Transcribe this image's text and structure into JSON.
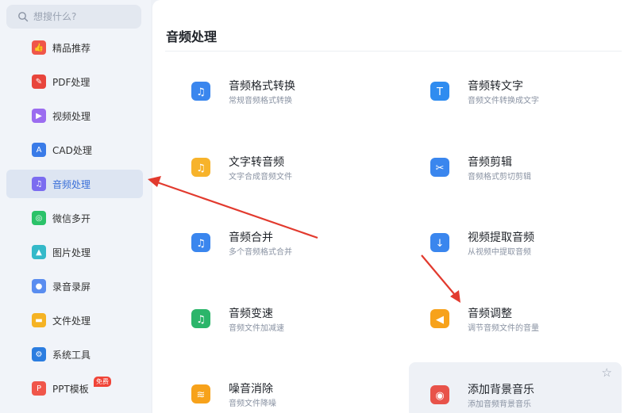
{
  "search": {
    "placeholder": "想搜什么?"
  },
  "sidebar": {
    "items": [
      {
        "label": "精品推荐",
        "color": "#f0564a",
        "glyph": "👍",
        "active": false
      },
      {
        "label": "PDF处理",
        "color": "#e8453c",
        "glyph": "✎",
        "active": false
      },
      {
        "label": "视频处理",
        "color": "#9b6cf0",
        "glyph": "▶",
        "active": false
      },
      {
        "label": "CAD处理",
        "color": "#3a7be8",
        "glyph": "A",
        "active": false
      },
      {
        "label": "音频处理",
        "color": "#7b6cf0",
        "glyph": "♫",
        "active": true
      },
      {
        "label": "微信多开",
        "color": "#2bc269",
        "glyph": "◎",
        "active": false
      },
      {
        "label": "图片处理",
        "color": "#34b9c9",
        "glyph": "▲",
        "active": false
      },
      {
        "label": "录音录屏",
        "color": "#5a8df0",
        "glyph": "●",
        "active": false
      },
      {
        "label": "文件处理",
        "color": "#f5b324",
        "glyph": "▬",
        "active": false
      },
      {
        "label": "系统工具",
        "color": "#2b7de0",
        "glyph": "⚙",
        "active": false
      },
      {
        "label": "PPT模板",
        "color": "#f0564a",
        "glyph": "P",
        "active": false,
        "badge": "免费"
      }
    ]
  },
  "main": {
    "title": "音频处理",
    "tools": [
      {
        "title": "音频格式转换",
        "desc": "常规音频格式转换",
        "color": "#3a86ee",
        "glyph": "♫"
      },
      {
        "title": "音频转文字",
        "desc": "音频文件转换成文字",
        "color": "#2f8cf0",
        "glyph": "T"
      },
      {
        "title": "文字转音频",
        "desc": "文字合成音频文件",
        "color": "#f7b32b",
        "glyph": "♫"
      },
      {
        "title": "音频剪辑",
        "desc": "音频格式剪切剪辑",
        "color": "#3a86ee",
        "glyph": "✂"
      },
      {
        "title": "音频合并",
        "desc": "多个音频格式合并",
        "color": "#3a86ee",
        "glyph": "♫"
      },
      {
        "title": "视频提取音频",
        "desc": "从视频中提取音频",
        "color": "#3a86ee",
        "glyph": "↓"
      },
      {
        "title": "音频变速",
        "desc": "音频文件加减速",
        "color": "#2bb56a",
        "glyph": "♫"
      },
      {
        "title": "音频调整",
        "desc": "调节音频文件的音量",
        "color": "#f7a21b",
        "glyph": "◀"
      },
      {
        "title": "噪音消除",
        "desc": "音频文件降噪",
        "color": "#f7a21b",
        "glyph": "≋"
      },
      {
        "title": "添加背景音乐",
        "desc": "添加音频背景音乐",
        "color": "#e8534a",
        "glyph": "◉"
      }
    ]
  },
  "arrow_color": "#e23a2e"
}
